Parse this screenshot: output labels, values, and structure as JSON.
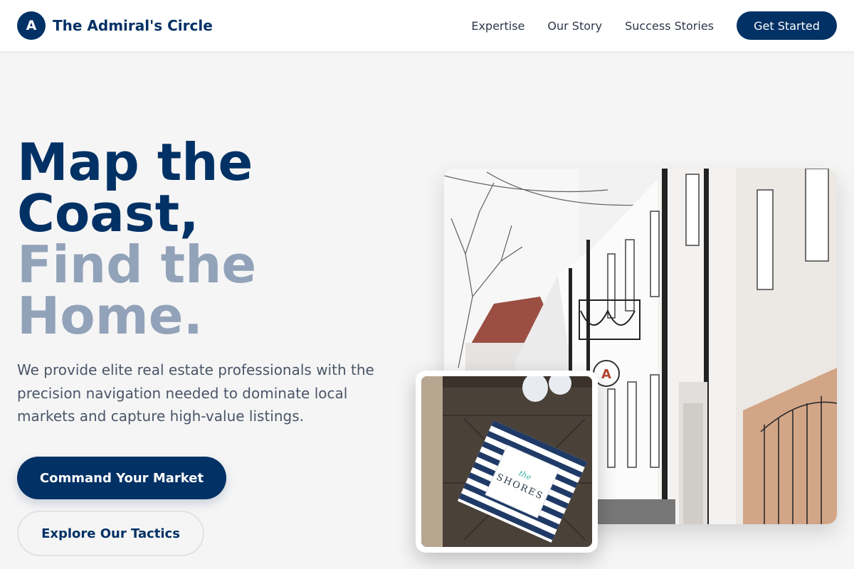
{
  "brand": {
    "logo_letter": "A",
    "name": "The Admiral's Circle"
  },
  "nav": {
    "links": [
      "Expertise",
      "Our Story",
      "Success Stories"
    ],
    "cta": "Get Started"
  },
  "hero": {
    "headline_line1": "Map the",
    "headline_line2": "Coast,",
    "headline_line3": "Find the",
    "headline_line4": "Home.",
    "description": "We provide elite real estate professionals with the precision navigation needed to dominate local markets and capture high-value listings.",
    "primary_cta": "Command Your Market",
    "secondary_cta": "Explore Our Tactics"
  },
  "images": {
    "main_photo": "white-building-with-balconies-photo",
    "card_photo": "the-shores-brochure-photo",
    "card_brochure_text_1": "the",
    "card_brochure_text_2": "SHORES"
  },
  "colors": {
    "navy": "#023165",
    "muted_headline": "#92a2b9",
    "body_text": "#4a5568",
    "background": "#f5f5f5"
  }
}
